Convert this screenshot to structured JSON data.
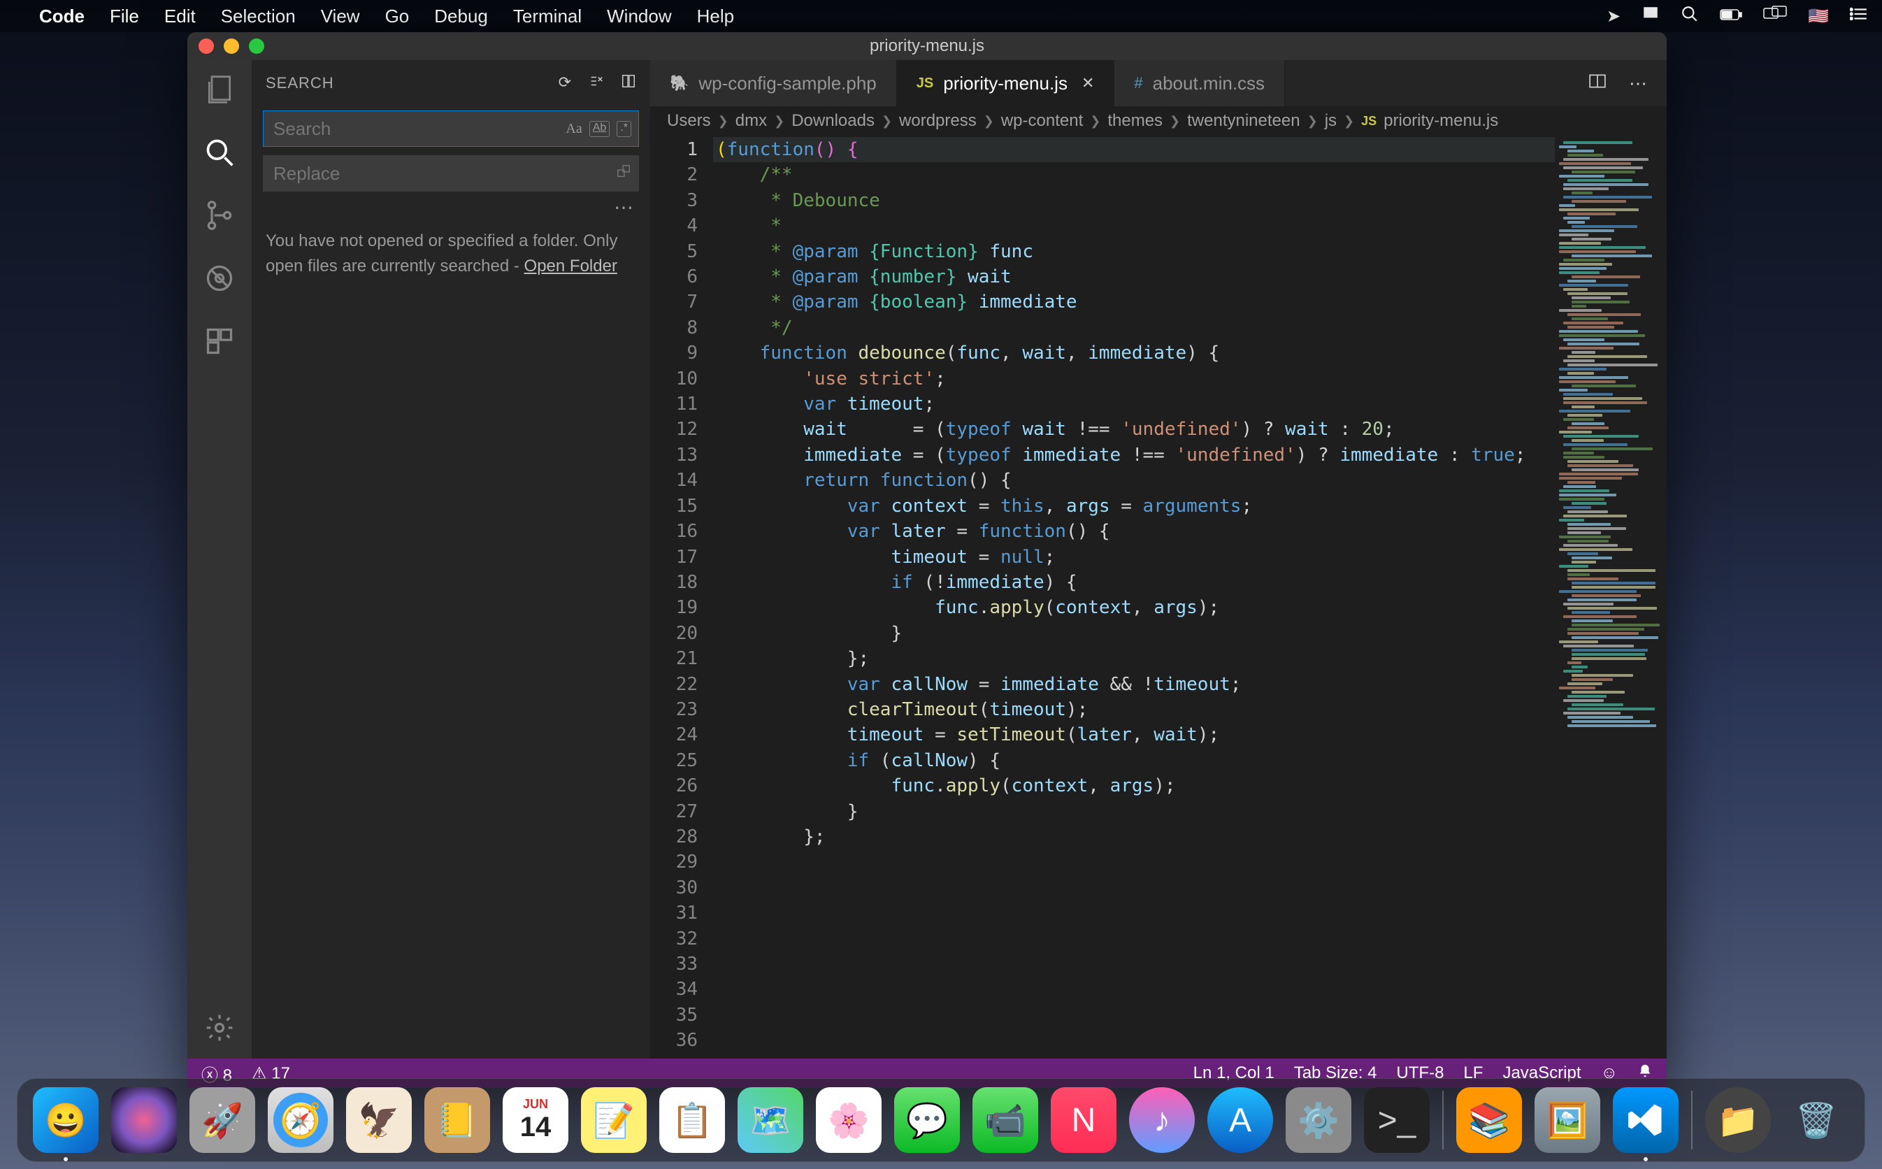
{
  "menubar": {
    "app_name": "Code",
    "items": [
      "File",
      "Edit",
      "Selection",
      "View",
      "Go",
      "Debug",
      "Terminal",
      "Window",
      "Help"
    ]
  },
  "window": {
    "title": "priority-menu.js"
  },
  "sidebar": {
    "title": "SEARCH",
    "search_placeholder": "Search",
    "replace_placeholder": "Replace",
    "msg_line1": "You have not opened or specified a folder.",
    "msg_line2": "Only open files are currently searched -",
    "open_folder": "Open Folder"
  },
  "tabs": [
    {
      "label": "wp-config-sample.php",
      "active": false,
      "icon": "php"
    },
    {
      "label": "priority-menu.js",
      "active": true,
      "icon": "js"
    },
    {
      "label": "about.min.css",
      "active": false,
      "icon": "css"
    }
  ],
  "breadcrumbs": [
    "Users",
    "dmx",
    "Downloads",
    "wordpress",
    "wp-content",
    "themes",
    "twentynineteen",
    "js",
    "priority-menu.js"
  ],
  "code_lines": [
    "(function() {",
    "",
    "    /**",
    "     * Debounce",
    "     *",
    "     * @param {Function} func",
    "     * @param {number} wait",
    "     * @param {boolean} immediate",
    "     */",
    "    function debounce(func, wait, immediate) {",
    "        'use strict';",
    "",
    "        var timeout;",
    "        wait      = (typeof wait !== 'undefined') ? wait : 20;",
    "        immediate = (typeof immediate !== 'undefined') ? immediate : true;",
    "",
    "        return function() {",
    "",
    "            var context = this, args = arguments;",
    "            var later = function() {",
    "                timeout = null;",
    "",
    "                if (!immediate) {",
    "                    func.apply(context, args);",
    "                }",
    "            };",
    "",
    "            var callNow = immediate && !timeout;",
    "",
    "            clearTimeout(timeout);",
    "            timeout = setTimeout(later, wait);",
    "",
    "            if (callNow) {",
    "                func.apply(context, args);",
    "            }",
    "        };"
  ],
  "statusbar": {
    "errors": "8",
    "warnings": "17",
    "ln_col": "Ln 1, Col 1",
    "tab_size": "Tab Size: 4",
    "encoding": "UTF-8",
    "eol": "LF",
    "language": "JavaScript"
  },
  "dock": {
    "calendar_month": "JUN",
    "calendar_day": "14"
  }
}
